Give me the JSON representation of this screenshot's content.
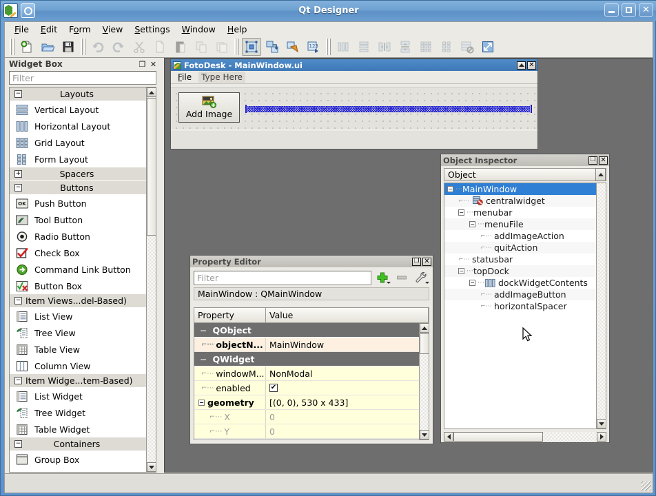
{
  "window": {
    "title": "Qt Designer",
    "icon": "qt-logo-icon",
    "buttons": {
      "minimize": "–",
      "maximize": "□",
      "close": "✕"
    }
  },
  "menubar": {
    "items": [
      {
        "name": "file",
        "mnemonic": "F",
        "rest": "ile"
      },
      {
        "name": "edit",
        "mnemonic": "E",
        "rest": "dit"
      },
      {
        "name": "form",
        "pre": "F",
        "mnemonic": "o",
        "rest": "rm"
      },
      {
        "name": "view",
        "mnemonic": "V",
        "rest": "iew"
      },
      {
        "name": "settings",
        "mnemonic": "S",
        "rest": "ettings"
      },
      {
        "name": "window",
        "mnemonic": "W",
        "rest": "indow"
      },
      {
        "name": "help",
        "mnemonic": "H",
        "rest": "elp"
      }
    ]
  },
  "toolbar": {
    "groups": [
      {
        "buttons": [
          {
            "name": "new-form-button",
            "icon": "new-document-icon",
            "enabled": true
          },
          {
            "name": "open-form-button",
            "icon": "open-folder-icon",
            "enabled": true
          },
          {
            "name": "save-form-button",
            "icon": "save-floppy-icon",
            "enabled": true
          }
        ]
      },
      {
        "buttons": [
          {
            "name": "undo-button",
            "icon": "undo-arrow-icon",
            "enabled": false
          },
          {
            "name": "redo-button",
            "icon": "redo-arrow-icon",
            "enabled": false
          },
          {
            "name": "cut-button",
            "icon": "scissors-icon",
            "enabled": false
          },
          {
            "name": "copy-button",
            "icon": "copy-pages-icon",
            "enabled": false
          },
          {
            "name": "paste-button",
            "icon": "clipboard-icon",
            "enabled": false
          },
          {
            "name": "clone-button",
            "icon": "clone-icon",
            "enabled": false
          },
          {
            "name": "dup-button",
            "icon": "duplicate-icon",
            "enabled": false
          }
        ]
      },
      {
        "buttons": [
          {
            "name": "edit-widgets-mode-button",
            "icon": "edit-widgets-icon",
            "enabled": true,
            "active": true
          },
          {
            "name": "edit-signals-mode-button",
            "icon": "signal-slot-icon",
            "enabled": true
          },
          {
            "name": "edit-buddies-mode-button",
            "icon": "buddy-label-icon",
            "enabled": true
          },
          {
            "name": "edit-taborder-mode-button",
            "icon": "tab-order-icon",
            "enabled": true
          }
        ]
      },
      {
        "buttons": [
          {
            "name": "layout-horizontal-button",
            "icon": "layout-horizontal-icon",
            "enabled": false
          },
          {
            "name": "layout-vertical-button",
            "icon": "layout-vertical-icon",
            "enabled": false
          },
          {
            "name": "layout-splitter-h-button",
            "icon": "splitter-horizontal-icon",
            "enabled": false
          },
          {
            "name": "layout-splitter-v-button",
            "icon": "splitter-vertical-icon",
            "enabled": false
          },
          {
            "name": "layout-grid-button",
            "icon": "layout-grid-icon",
            "enabled": false
          },
          {
            "name": "layout-form-button",
            "icon": "layout-form-icon",
            "enabled": false
          },
          {
            "name": "break-layout-button",
            "icon": "break-layout-icon",
            "enabled": false
          },
          {
            "name": "adjust-size-button",
            "icon": "adjust-size-icon",
            "enabled": true
          }
        ]
      }
    ]
  },
  "widget_box": {
    "title": "Widget Box",
    "float_button": "❐",
    "close_button": "✕",
    "filter_placeholder": "Filter",
    "entries": [
      {
        "kind": "category",
        "label": "Layouts",
        "expanded": true,
        "sign": "−"
      },
      {
        "kind": "item",
        "label": "Vertical Layout",
        "icon": "vertical-layout-icon"
      },
      {
        "kind": "item",
        "label": "Horizontal Layout",
        "icon": "horizontal-layout-icon"
      },
      {
        "kind": "item",
        "label": "Grid Layout",
        "icon": "grid-layout-icon"
      },
      {
        "kind": "item",
        "label": "Form Layout",
        "icon": "form-layout-icon"
      },
      {
        "kind": "category",
        "label": "Spacers",
        "expanded": false,
        "sign": "+"
      },
      {
        "kind": "category",
        "label": "Buttons",
        "expanded": true,
        "sign": "−"
      },
      {
        "kind": "item",
        "label": "Push Button",
        "icon": "push-button-icon"
      },
      {
        "kind": "item",
        "label": "Tool Button",
        "icon": "tool-button-icon"
      },
      {
        "kind": "item",
        "label": "Radio Button",
        "icon": "radio-button-icon"
      },
      {
        "kind": "item",
        "label": "Check Box",
        "icon": "check-box-icon"
      },
      {
        "kind": "item",
        "label": "Command Link Button",
        "icon": "command-link-icon"
      },
      {
        "kind": "item",
        "label": "Button Box",
        "icon": "button-box-icon"
      },
      {
        "kind": "category",
        "label": "Item Views...del-Based)",
        "expanded": true,
        "sign": "−",
        "left": true
      },
      {
        "kind": "item",
        "label": "List View",
        "icon": "list-view-icon"
      },
      {
        "kind": "item",
        "label": "Tree View",
        "icon": "tree-view-icon"
      },
      {
        "kind": "item",
        "label": "Table View",
        "icon": "table-view-icon"
      },
      {
        "kind": "item",
        "label": "Column View",
        "icon": "column-view-icon"
      },
      {
        "kind": "category",
        "label": "Item Widge...tem-Based)",
        "expanded": true,
        "sign": "−",
        "left": true
      },
      {
        "kind": "item",
        "label": "List Widget",
        "icon": "list-widget-icon"
      },
      {
        "kind": "item",
        "label": "Tree Widget",
        "icon": "tree-widget-icon"
      },
      {
        "kind": "item",
        "label": "Table Widget",
        "icon": "table-widget-icon"
      },
      {
        "kind": "category",
        "label": "Containers",
        "expanded": true,
        "sign": "−"
      },
      {
        "kind": "item",
        "label": "Group Box",
        "icon": "group-box-icon"
      }
    ]
  },
  "form_window": {
    "title": "FotoDesk - MainWindow.ui",
    "icon": "qt-form-icon",
    "buttons": {
      "restore": "❐",
      "close": "✕"
    },
    "menu": [
      {
        "name": "file",
        "mnemonic": "F",
        "rest": "ile",
        "placeholder": false
      },
      {
        "name": "type-here",
        "label": "Type Here",
        "placeholder": true
      }
    ],
    "add_image_button": {
      "label": "Add Image",
      "icon": "add-image-icon"
    },
    "spacer": {
      "name": "horizontalSpacer"
    }
  },
  "object_inspector": {
    "title": "Object Inspector",
    "float_button": "❐",
    "close_button": "✕",
    "column_header": "Object",
    "rows": [
      {
        "label": "MainWindow",
        "indent": 0,
        "expander": "−",
        "selected": true,
        "icon": null
      },
      {
        "label": "centralwidget",
        "indent": 1,
        "expander": null,
        "icon": "central-widget-icon"
      },
      {
        "label": "menubar",
        "indent": 1,
        "expander": "−",
        "icon": null
      },
      {
        "label": "menuFile",
        "indent": 2,
        "expander": "−",
        "icon": null
      },
      {
        "label": "addImageAction",
        "indent": 3,
        "expander": null,
        "icon": null
      },
      {
        "label": "quitAction",
        "indent": 3,
        "expander": null,
        "icon": null
      },
      {
        "label": "statusbar",
        "indent": 1,
        "expander": null,
        "icon": null
      },
      {
        "label": "topDock",
        "indent": 1,
        "expander": "−",
        "icon": null
      },
      {
        "label": "dockWidgetContents",
        "indent": 2,
        "expander": "−",
        "icon": "horizontal-layout-icon"
      },
      {
        "label": "addImageButton",
        "indent": 3,
        "expander": null,
        "icon": null
      },
      {
        "label": "horizontalSpacer",
        "indent": 3,
        "expander": null,
        "icon": null
      }
    ]
  },
  "property_editor": {
    "title": "Property Editor",
    "float_button": "❐",
    "close_button": "✕",
    "filter_placeholder": "Filter",
    "tools": [
      {
        "name": "add-dynamic-property-button",
        "icon": "plus-icon"
      },
      {
        "name": "remove-dynamic-property-button",
        "icon": "minus-icon"
      },
      {
        "name": "configure-property-editor-button",
        "icon": "wrench-icon"
      }
    ],
    "object_line": "MainWindow : QMainWindow",
    "columns": {
      "property": "Property",
      "value": "Value"
    },
    "rows": [
      {
        "type": "group",
        "name": "QObject",
        "sign": "−"
      },
      {
        "type": "prop",
        "name": "objectN...",
        "value": "MainWindow",
        "style": "peach",
        "bold": true,
        "expander": null
      },
      {
        "type": "group",
        "name": "QWidget",
        "sign": "−"
      },
      {
        "type": "prop",
        "name": "windowM...",
        "value": "NonModal",
        "style": "yellow",
        "bold": false,
        "expander": null
      },
      {
        "type": "prop",
        "name": "enabled",
        "value": "",
        "style": "yellow",
        "bold": false,
        "expander": null,
        "checkbox": true
      },
      {
        "type": "prop",
        "name": "geometry",
        "value": "[(0, 0), 530 x 433]",
        "style": "yellow",
        "bold": true,
        "expander": "−"
      },
      {
        "type": "sub",
        "name": "X",
        "value": "0",
        "style": "yellow"
      },
      {
        "type": "sub",
        "name": "Y",
        "value": "0",
        "style": "yellow"
      }
    ]
  },
  "colors": {
    "titlebar_blue": "#5e92cc",
    "mdi_background": "#6e6e6e",
    "panel_background": "#eceae4",
    "selection_blue": "#2f7fd4",
    "property_peach": "#fdf0e0",
    "property_yellow": "#ffffdc",
    "group_header_gray": "#6e6e6e",
    "spacer_blue": "#2222d4"
  }
}
